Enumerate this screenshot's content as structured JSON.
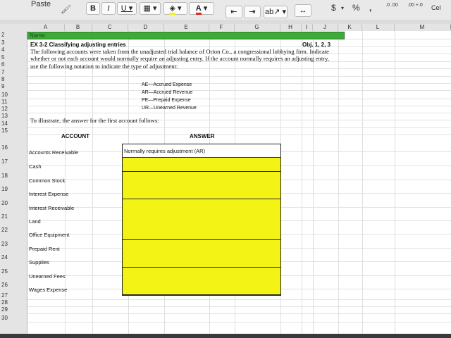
{
  "ribbon": {
    "paste_label": "Paste",
    "bold": "B",
    "italic": "I",
    "underline": "U",
    "font_color_glyph": "A",
    "currency": "$",
    "percent": "%",
    "comma": ",",
    "inc_decimal": ".0 .00",
    "dec_decimal": ".00 +.0",
    "cell_styles": "Cel",
    "accent_yellow": "#f3f316",
    "accent_green": "#3faa3a",
    "font_color_red": "#e0261a"
  },
  "columns": [
    "A",
    "B",
    "C",
    "D",
    "E",
    "F",
    "G",
    "H",
    "I",
    "J",
    "K",
    "L",
    "M",
    "N"
  ],
  "rows": [
    "2",
    "3",
    "4",
    "5",
    "6",
    "7",
    "8",
    "9",
    "10",
    "11",
    "12",
    "13",
    "14",
    "15",
    "16",
    "17",
    "18",
    "19",
    "20",
    "21",
    "22",
    "23",
    "24",
    "25",
    "26",
    "27",
    "28",
    "29",
    "30"
  ],
  "sheet": {
    "name_label": "Name:",
    "exercise_title": "EX 3-2   Classifying adjusting entries",
    "objective": "Obj. 1, 2, 3",
    "paragraph": "The following accounts were taken from the unadjusted trial balance of Orion Co., a congressional lobbying firm. Indicate whether or not each account would normally require an adjusting entry. If the account normally requires an adjusting entry, use the following notation to indicate the type of adjustment:",
    "codes": [
      "AE—Accrued Expense",
      "AR—Accrued Revenue",
      "PE—Prepaid Expense",
      "UR—Unearned Revenue"
    ],
    "illustrate": "To illustrate, the answer for the first account follows:",
    "account_header": "ACCOUNT",
    "answer_header": "ANSWER",
    "first_answer": "Normally requires adjustment (AR)",
    "accounts": [
      "Accounts Receivable",
      "Cash",
      "Common Stock",
      "Interest Expense",
      "Interest Receivable",
      "Land",
      "Office Equipment",
      "Prepaid Rent",
      "Supplies",
      "Unearned Fees",
      "Wages Expense"
    ]
  }
}
